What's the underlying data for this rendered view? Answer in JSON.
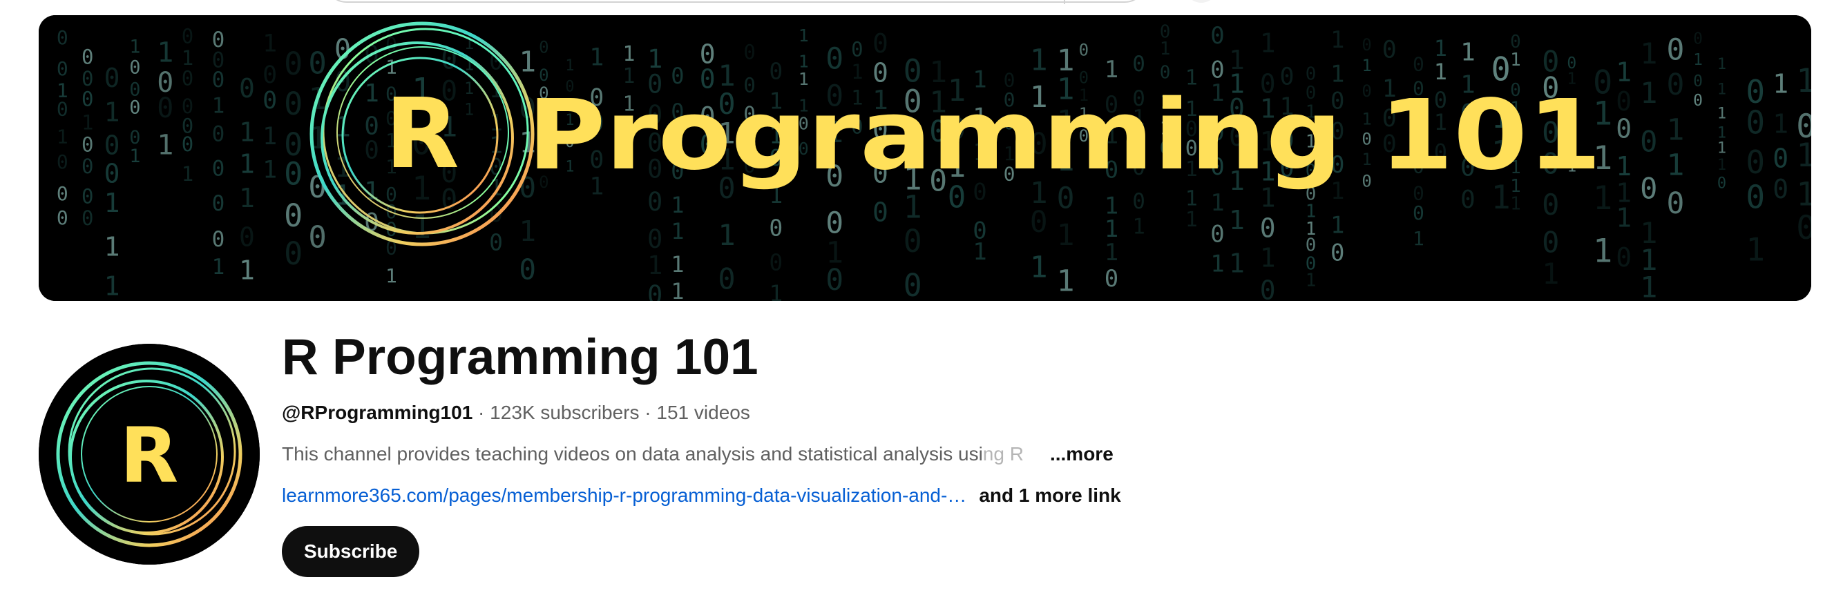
{
  "banner": {
    "title_letter": "R",
    "title_text": "Programming 101",
    "accent_color": "#ffe05a"
  },
  "avatar": {
    "letter": "R"
  },
  "channel": {
    "name": "R Programming 101",
    "handle": "@RProgramming101",
    "separator": " · ",
    "subscribers": "123K subscribers",
    "videos": "151 videos",
    "description": "This channel provides teaching videos on data analysis and statistical analysis usi",
    "description_fade": "ng R",
    "more_label": "...more",
    "link_text": "learnmore365.com/pages/membership-r-programming-data-visualization-and-…",
    "more_links_label": "and 1 more link",
    "subscribe_label": "Subscribe"
  },
  "colors": {
    "link": "#065fd4",
    "subscribe_bg": "#0f0f0f",
    "banner_bg": "#000000",
    "banner_text": "#ffe05a"
  }
}
